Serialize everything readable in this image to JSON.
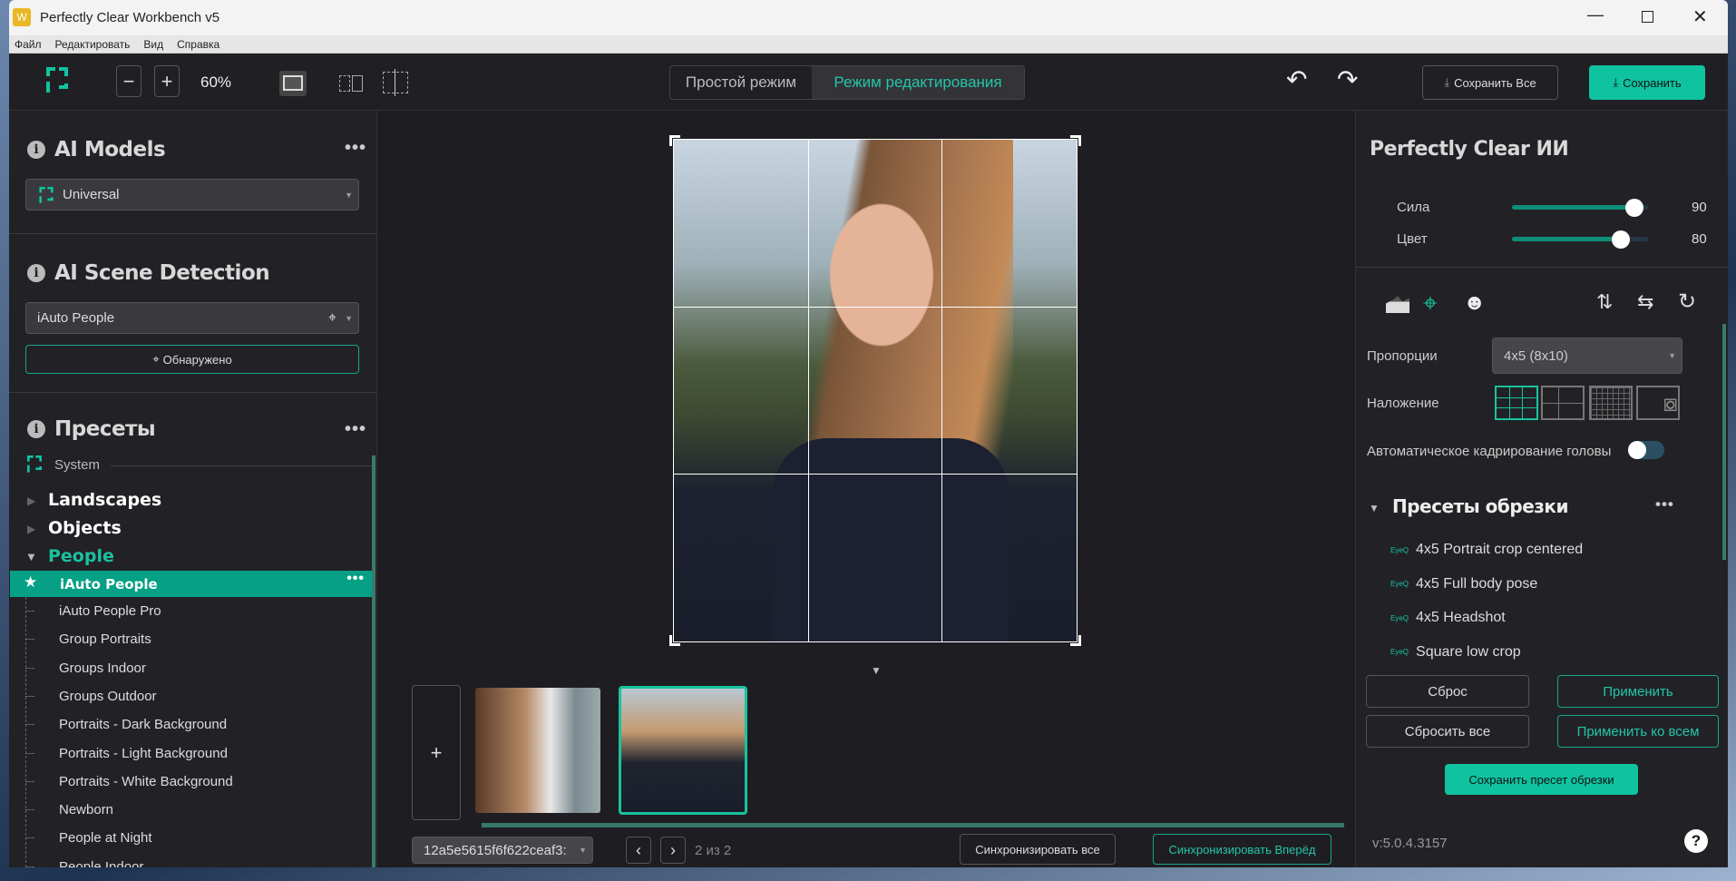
{
  "window": {
    "title": "Perfectly Clear Workbench v5",
    "app_icon": "W"
  },
  "menu": [
    "Файл",
    "Редактировать",
    "Вид",
    "Справка"
  ],
  "toolbar": {
    "zoom": "60%",
    "mode_simple": "Простой режим",
    "mode_edit": "Режим редактирования",
    "save_all": "Сохранить Все",
    "save": "Сохранить"
  },
  "left": {
    "ai_models_title": "AI Models",
    "ai_model_value": "Universal",
    "scene_title": "AI Scene Detection",
    "scene_value": "iAuto People",
    "detected_label": "Обнаружено",
    "presets_title": "Пресеты",
    "system_label": "System",
    "groups": [
      "Landscapes",
      "Objects",
      "People"
    ],
    "selected_preset": "iAuto People",
    "people_presets": [
      "iAuto People Pro",
      "Group Portraits",
      "Groups Indoor",
      "Groups Outdoor",
      "Portraits - Dark Background",
      "Portraits - Light Background",
      "Portraits - White Background",
      "Newborn",
      "People at Night",
      "People Indoor"
    ]
  },
  "center": {
    "file_select": "12a5e5615f6f622ceaf3:",
    "page_indicator": "2 из 2",
    "sync_all": "Синхронизировать все",
    "sync_forward": "Синхронизировать Вперёд",
    "add_label": "+"
  },
  "right": {
    "title": "Perfectly Clear ИИ",
    "sliders": [
      {
        "label": "Сила",
        "value": 90,
        "fraction": 0.9
      },
      {
        "label": "Цвет",
        "value": 80,
        "fraction": 0.8
      }
    ],
    "proportions_label": "Пропорции",
    "proportions_value": "4x5 (8x10)",
    "overlay_label": "Наложение",
    "auto_head_crop_label": "Автоматическое кадрирование головы",
    "auto_head_crop": false,
    "crop_presets_title": "Пресеты обрезки",
    "crop_presets": [
      {
        "badge": "EyeQ",
        "label": "4x5 Portrait crop centered"
      },
      {
        "badge": "EyeQ",
        "label": "4x5 Full body pose"
      },
      {
        "badge": "EyeQ",
        "label": "4x5 Headshot"
      },
      {
        "badge": "EyeQ",
        "label": "Square low crop"
      }
    ],
    "reset": "Сброс",
    "apply": "Применить",
    "reset_all": "Сбросить все",
    "apply_all": "Применить ко всем",
    "save_crop_preset": "Сохранить пресет обрезки",
    "version": "v:5.0.4.3157",
    "help": "?"
  },
  "colors": {
    "accent": "#10c3a0",
    "panel": "#222226",
    "bg": "#1e1e22"
  }
}
